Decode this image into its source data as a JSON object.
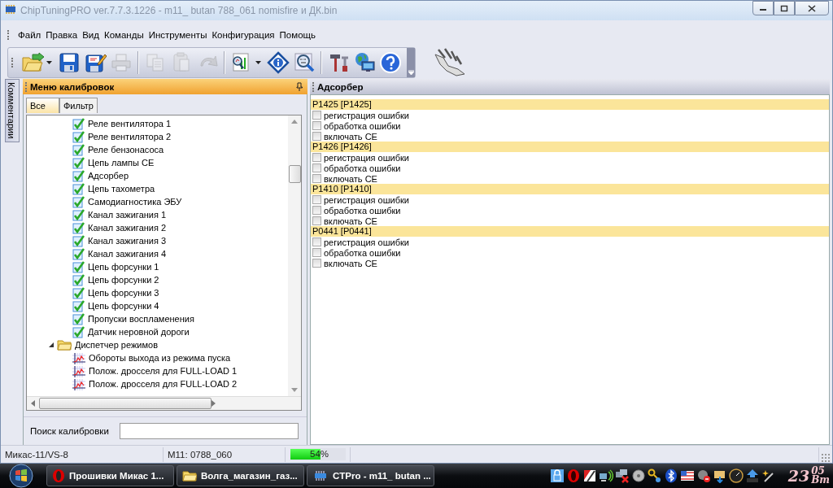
{
  "window": {
    "title": "ChipTuningPRO ver.7.7.3.1226 - m11_ butan 788_061 nomisfire и ДК.bin"
  },
  "menu": [
    "Файл",
    "Правка",
    "Вид",
    "Команды",
    "Инструменты",
    "Конфигурация",
    "Помощь"
  ],
  "toolbar": [
    [
      {
        "kind": "open",
        "has_menu": true,
        "disabled": false
      },
      {
        "kind": "save",
        "has_menu": false,
        "disabled": false
      },
      {
        "kind": "save-edit",
        "has_menu": false,
        "disabled": false
      },
      {
        "kind": "print",
        "has_menu": false,
        "disabled": true
      }
    ],
    [
      {
        "kind": "copy",
        "has_menu": false,
        "disabled": true
      },
      {
        "kind": "paste",
        "has_menu": false,
        "disabled": true
      },
      {
        "kind": "undo",
        "has_menu": false,
        "disabled": true
      }
    ],
    [
      {
        "kind": "chart",
        "has_menu": true,
        "disabled": false
      },
      {
        "kind": "info",
        "has_menu": false,
        "disabled": false
      },
      {
        "kind": "hex",
        "has_menu": false,
        "disabled": false
      }
    ],
    [
      {
        "kind": "tools",
        "has_menu": false,
        "disabled": false
      },
      {
        "kind": "web",
        "has_menu": false,
        "disabled": false
      },
      {
        "kind": "help",
        "has_menu": false,
        "disabled": false
      }
    ]
  ],
  "side_tab": {
    "label": "Комментарии"
  },
  "left_panel": {
    "title": "Меню калибровок",
    "tabs": [
      {
        "label": "Все",
        "selected": true
      },
      {
        "label": "Фильтр",
        "selected": false
      }
    ],
    "tree": [
      {
        "kind": "group",
        "children": [
          {
            "kind": "check",
            "label": "Реле вентилятора 1"
          },
          {
            "kind": "check",
            "label": "Реле вентилятора 2"
          },
          {
            "kind": "check",
            "label": "Реле бензонасоса"
          },
          {
            "kind": "check",
            "label": "Цепь лампы CE"
          },
          {
            "kind": "check",
            "label": "Адсорбер"
          },
          {
            "kind": "check",
            "label": "Цепь тахометра"
          },
          {
            "kind": "check",
            "label": "Самодиагностика ЭБУ"
          },
          {
            "kind": "check",
            "label": "Канал зажигания 1"
          },
          {
            "kind": "check",
            "label": "Канал зажигания 2"
          },
          {
            "kind": "check",
            "label": "Канал зажигания 3"
          },
          {
            "kind": "check",
            "label": "Канал зажигания 4"
          },
          {
            "kind": "check",
            "label": "Цепь форсунки 1"
          },
          {
            "kind": "check",
            "label": "Цепь форсунки 2"
          },
          {
            "kind": "check",
            "label": "Цепь форсунки 3"
          },
          {
            "kind": "check",
            "label": "Цепь форсунки 4"
          },
          {
            "kind": "check",
            "label": "Пропуски воспламенения"
          },
          {
            "kind": "check",
            "label": "Датчик неровной дороги"
          }
        ]
      },
      {
        "kind": "folder",
        "label": "Диспетчер режимов",
        "expanded": true,
        "children": [
          {
            "kind": "map",
            "label": "Обороты выхода из режима пуска"
          },
          {
            "kind": "map",
            "label": "Полож. дросселя для FULL-LOAD 1"
          },
          {
            "kind": "map",
            "label": "Полож. дросселя для FULL-LOAD 2"
          }
        ]
      }
    ],
    "search": {
      "label": "Поиск калибровки"
    }
  },
  "right_panel": {
    "title": "Адсорбер",
    "errors": [
      {
        "code": "P1425 [P1425]",
        "options": [
          {
            "label": "регистрация ошибки",
            "checked": false
          },
          {
            "label": "обработка ошибки",
            "checked": false
          },
          {
            "label": "включать CE",
            "checked": false
          }
        ]
      },
      {
        "code": "P1426 [P1426]",
        "options": [
          {
            "label": "регистрация ошибки",
            "checked": false
          },
          {
            "label": "обработка ошибки",
            "checked": false
          },
          {
            "label": "включать CE",
            "checked": false
          }
        ]
      },
      {
        "code": "P1410 [P1410]",
        "options": [
          {
            "label": "регистрация ошибки",
            "checked": false
          },
          {
            "label": "обработка ошибки",
            "checked": false
          },
          {
            "label": "включать CE",
            "checked": false
          }
        ]
      },
      {
        "code": "P0441 [P0441]",
        "options": [
          {
            "label": "регистрация ошибки",
            "checked": false
          },
          {
            "label": "обработка ошибки",
            "checked": false
          },
          {
            "label": "включать CE",
            "checked": false
          }
        ]
      }
    ]
  },
  "status_bar": {
    "ecu": "Микас-11/VS-8",
    "firmware": "M11: 0788_060",
    "progress": {
      "level": 0.54,
      "reading": "54%"
    }
  },
  "taskbar": {
    "buttons": [
      {
        "kind": "browser",
        "label": "Прошивки Микас 1..."
      },
      {
        "kind": "folder",
        "label": "Волга_магазин_газ..."
      },
      {
        "kind": "app",
        "label": "CTPro - m11_ butan ..."
      }
    ],
    "clock": {
      "hour": "23",
      "minute": "05",
      "day": "Вт"
    }
  }
}
